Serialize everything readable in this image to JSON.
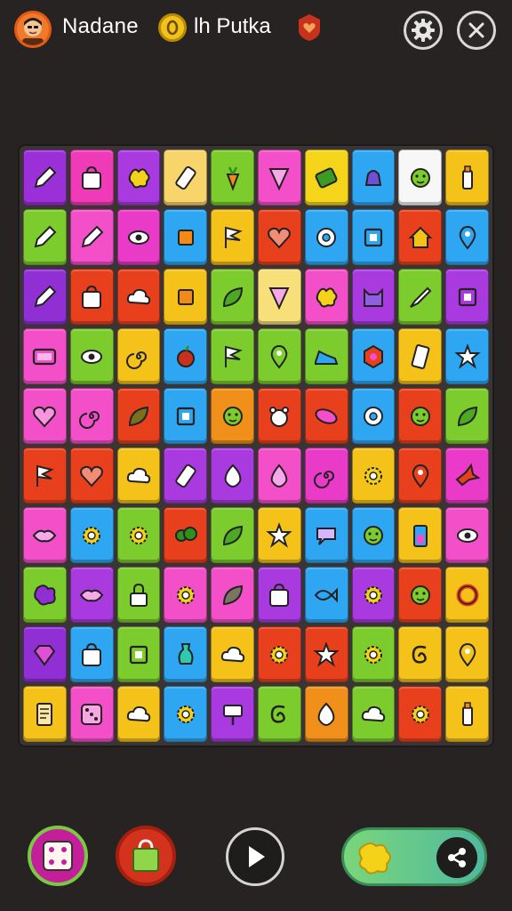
{
  "header": {
    "player_name": "Nadane",
    "coin_label": "lh Putka",
    "avatar_icon": "avatar-face-icon",
    "coin_icon": "coin-icon",
    "heart_icon": "heart-badge-icon",
    "settings_icon": "gear-icon",
    "close_icon": "close-icon"
  },
  "board": {
    "rows": 10,
    "cols": 10,
    "tiles": [
      [
        "#9b2fd8",
        "#f03bb8",
        "#a93ae0",
        "#f7d56a",
        "#7ccc2d",
        "#f24fc8",
        "#f5d51a",
        "#2ea6f2",
        "#f7f7f7",
        "#f5c21a"
      ],
      [
        "#7ccc2d",
        "#f24fc8",
        "#e93ac8",
        "#2ea6f2",
        "#f5c21a",
        "#e8401c",
        "#2ea6f2",
        "#2ea6f2",
        "#e8401c",
        "#2ea6f2"
      ],
      [
        "#8f2fd4",
        "#e8401c",
        "#e8401c",
        "#f5c21a",
        "#7ccc2d",
        "#f7e07a",
        "#f24fc8",
        "#a93ae0",
        "#7ccc2d",
        "#a93ae0"
      ],
      [
        "#f24fc8",
        "#7ccc2d",
        "#f5c21a",
        "#2ea6f2",
        "#7ccc2d",
        "#7ccc2d",
        "#7ccc2d",
        "#2ea6f2",
        "#f5c21a",
        "#2ea6f2"
      ],
      [
        "#f24fc8",
        "#f24fc8",
        "#e8401c",
        "#2ea6f2",
        "#f0901a",
        "#e8401c",
        "#e8401c",
        "#2ea6f2",
        "#e8401c",
        "#7ccc2d"
      ],
      [
        "#e8401c",
        "#e8401c",
        "#f5c21a",
        "#a93ae0",
        "#a93ae0",
        "#f24fc8",
        "#e93ac8",
        "#f5c21a",
        "#e8401c",
        "#e93ac8"
      ],
      [
        "#f24fc8",
        "#2ea6f2",
        "#7ccc2d",
        "#e8401c",
        "#7ccc2d",
        "#f5c21a",
        "#2ea6f2",
        "#2ea6f2",
        "#f5c21a",
        "#f24fc8"
      ],
      [
        "#7ccc2d",
        "#a93ae0",
        "#7ccc2d",
        "#f24fc8",
        "#f24fc8",
        "#a93ae0",
        "#2ea6f2",
        "#a93ae0",
        "#e8401c",
        "#f5c21a"
      ],
      [
        "#8f2fd4",
        "#2ea6f2",
        "#7ccc2d",
        "#2ea6f2",
        "#f5c21a",
        "#e8401c",
        "#e8401c",
        "#7ccc2d",
        "#f5c21a",
        "#f5c21a"
      ],
      [
        "#f5c21a",
        "#f24fc8",
        "#f5c21a",
        "#2ea6f2",
        "#a93ae0",
        "#7ccc2d",
        "#f0901a",
        "#7ccc2d",
        "#e8401c",
        "#f5c21a"
      ]
    ],
    "icons": [
      [
        "pencil-icon",
        "bag-icon",
        "splash-icon",
        "tube-icon",
        "carrot-icon",
        "triangle-icon",
        "leaf-tool-icon",
        "bell-icon",
        "face-icon",
        "bottle-icon"
      ],
      [
        "pencil-icon",
        "pencil-icon",
        "eye-icon",
        "cube-icon",
        "flag-icon",
        "heart-icon",
        "donut-icon",
        "box-icon",
        "house-icon",
        "pin-icon"
      ],
      [
        "pencil-icon",
        "bag-icon",
        "cloud-icon",
        "cube-icon",
        "leaf-icon",
        "triangle-icon",
        "splash-icon",
        "cat-icon",
        "brush-icon",
        "box-icon"
      ],
      [
        "tv-icon",
        "eye-icon",
        "spiral-icon",
        "apple-icon",
        "flag-icon",
        "pin-icon",
        "shoe-icon",
        "hexagon-icon",
        "phone-icon",
        "star-icon"
      ],
      [
        "heart-icon",
        "spiral-icon",
        "leaf-icon",
        "box-icon",
        "face-icon",
        "bear-icon",
        "oval-icon",
        "donut-icon",
        "face-icon",
        "leaf-icon"
      ],
      [
        "flag-icon",
        "heart-icon",
        "cloud-icon",
        "tube-icon",
        "egg-icon",
        "drop-icon",
        "spiral-icon",
        "gear-icon",
        "pin-icon",
        "bird-icon"
      ],
      [
        "lips-icon",
        "gear-icon",
        "gear-icon",
        "bush-icon",
        "leaf-icon",
        "star-icon",
        "bubble-icon",
        "face-icon",
        "battery-icon",
        "eye-icon"
      ],
      [
        "blob-icon",
        "lips-icon",
        "lock-icon",
        "gear-icon",
        "leaf-icon",
        "bag-icon",
        "fish-icon",
        "gear-icon",
        "face-icon",
        "ring-icon"
      ],
      [
        "gem-icon",
        "bag-icon",
        "box-icon",
        "vase-icon",
        "cloud-icon",
        "gear-icon",
        "star-icon",
        "gear-icon",
        "swirl-icon",
        "pin-icon"
      ],
      [
        "doc-icon",
        "dice-icon",
        "cloud-icon",
        "gear-icon",
        "sign-icon",
        "swirl-icon",
        "egg-icon",
        "cloud-icon",
        "gear-icon",
        "bottle-icon"
      ]
    ]
  },
  "bottom": {
    "dice_icon": "dice-icon",
    "shop_icon": "shopping-bag-icon",
    "play_icon": "play-icon",
    "powerup_icon": "yellow-blob-icon",
    "share_icon": "share-icon"
  }
}
